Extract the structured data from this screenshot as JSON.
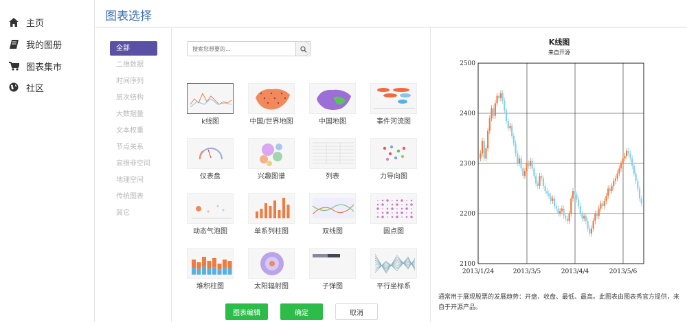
{
  "nav": {
    "items": [
      {
        "label": "主页",
        "icon": "home-icon"
      },
      {
        "label": "我的图册",
        "icon": "book-icon"
      },
      {
        "label": "图表集市",
        "icon": "cart-icon"
      },
      {
        "label": "社区",
        "icon": "globe-icon"
      }
    ]
  },
  "header": {
    "title": "图表选择"
  },
  "categories": [
    "全部",
    "二维数据",
    "时间序列",
    "层次结构",
    "大数据量",
    "文本权重",
    "节点关系",
    "高维非空间",
    "地理空间",
    "传统图表",
    "其它"
  ],
  "search": {
    "placeholder": "搜索您想要的..."
  },
  "charts": [
    {
      "name": "k线图"
    },
    {
      "name": "中国/世界地图"
    },
    {
      "name": "中国地图"
    },
    {
      "name": "事件河流图"
    },
    {
      "name": "仪表盘"
    },
    {
      "name": "兴趣图谱"
    },
    {
      "name": "列表"
    },
    {
      "name": "力导向图"
    },
    {
      "name": "动态气泡图"
    },
    {
      "name": "单系列柱图"
    },
    {
      "name": "双线图"
    },
    {
      "name": "圆点图"
    },
    {
      "name": "堆积柱图"
    },
    {
      "name": "太阳辐射图"
    },
    {
      "name": "子弹图"
    },
    {
      "name": "平行坐标系"
    }
  ],
  "buttons": {
    "edit": "图表编辑",
    "confirm": "确定",
    "cancel": "取消"
  },
  "preview": {
    "title": "K线图",
    "subtitle": "来自开源",
    "description": "通常用于展现股票的发展趋势：开盘、收盘、最低、最高。此图表由图表秀官方提供，来自于开源产品。"
  },
  "colors": {
    "accent": "#5b51a4",
    "header_title": "#3a6fb0",
    "green": "#2dbb4a",
    "up": "#f07b3f",
    "down": "#87ceeb"
  },
  "chart_data": {
    "type": "candlestick",
    "title": "K线图",
    "subtitle": "来自开源",
    "x_ticks": [
      "2013/1/24",
      "2013/3/5",
      "2013/4/4",
      "2013/5/6"
    ],
    "y_ticks": [
      2100,
      2200,
      2300,
      2400,
      2500
    ],
    "ylim": [
      2100,
      2500
    ],
    "grid": true,
    "close": [
      2320,
      2345,
      2310,
      2330,
      2365,
      2390,
      2410,
      2395,
      2420,
      2435,
      2430,
      2440,
      2425,
      2405,
      2385,
      2370,
      2375,
      2355,
      2340,
      2320,
      2300,
      2310,
      2290,
      2275,
      2285,
      2300,
      2295,
      2305,
      2290,
      2275,
      2260,
      2255,
      2275,
      2270,
      2255,
      2245,
      2240,
      2235,
      2225,
      2230,
      2215,
      2210,
      2200,
      2205,
      2210,
      2195,
      2190,
      2185,
      2200,
      2230,
      2245,
      2238,
      2228,
      2215,
      2200,
      2190,
      2195,
      2185,
      2170,
      2160,
      2170,
      2185,
      2200,
      2195,
      2210,
      2220,
      2215,
      2225,
      2235,
      2250,
      2245,
      2255,
      2265,
      2270,
      2280,
      2290,
      2300,
      2310,
      2315,
      2325,
      2320,
      2310,
      2295,
      2280,
      2265,
      2250,
      2230,
      2220
    ]
  }
}
